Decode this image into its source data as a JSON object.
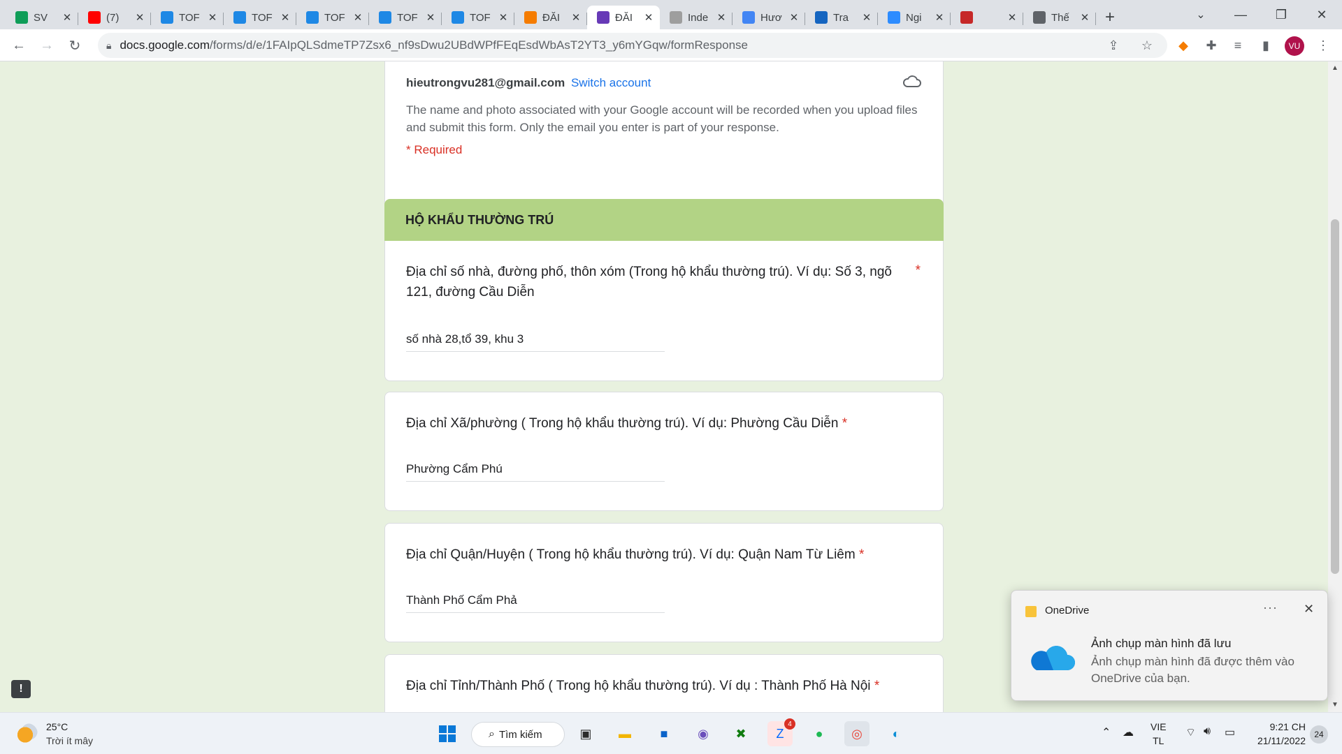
{
  "browser": {
    "tabs": [
      {
        "title": "SV",
        "icon": "sheets-icon",
        "color": "#0f9d58",
        "active": false
      },
      {
        "title": "(7)",
        "icon": "youtube-icon",
        "color": "#ff0000",
        "active": false
      },
      {
        "title": "TOF",
        "icon": "site-icon",
        "color": "#1e88e5",
        "active": false
      },
      {
        "title": "TOF",
        "icon": "site-icon",
        "color": "#1e88e5",
        "active": false
      },
      {
        "title": "TOF",
        "icon": "site-icon",
        "color": "#1e88e5",
        "active": false
      },
      {
        "title": "TOF",
        "icon": "site-icon",
        "color": "#1e88e5",
        "active": false
      },
      {
        "title": "TOF",
        "icon": "site-icon",
        "color": "#1e88e5",
        "active": false
      },
      {
        "title": "ĐĂI",
        "icon": "fpt-icon",
        "color": "#f57c00",
        "active": false
      },
      {
        "title": "ĐĂI",
        "icon": "forms-icon",
        "color": "#673ab7",
        "active": true
      },
      {
        "title": "Inde",
        "icon": "page-icon",
        "color": "#9e9e9e",
        "active": false
      },
      {
        "title": "Hươ",
        "icon": "docs-icon",
        "color": "#4285f4",
        "active": false
      },
      {
        "title": "Tra",
        "icon": "globe-icon",
        "color": "#1565c0",
        "active": false
      },
      {
        "title": "Ngi",
        "icon": "zoom-icon",
        "color": "#2d8cff",
        "active": false
      },
      {
        "title": "",
        "icon": "audio-icon",
        "color": "#c62828",
        "active": false
      },
      {
        "title": "Thế",
        "icon": "chrome-icon",
        "color": "#5f6368",
        "active": false
      }
    ],
    "url_host": "docs.google.com",
    "url_path": "/forms/d/e/1FAIpQLSdmeTP7Zsx6_nf9sDwu2UBdWPfFEqEsdWbAsT2YT3_y6mYGqw/formResponse",
    "profile_initials": "VU"
  },
  "form": {
    "account_email": "hieutrongvu281@gmail.com",
    "switch_account": "Switch account",
    "notice": "The name and photo associated with your Google account will be recorded when you upload files and submit this form. Only the email you enter is part of your response.",
    "required_note": "* Required",
    "section_title": "HỘ KHẨU THƯỜNG TRÚ",
    "questions": [
      {
        "title": "Địa chỉ số nhà, đường phố, thôn xóm (Trong hộ khẩu thường trú). Ví dụ: Số 3, ngõ 121, đường Cầu Diễn",
        "required": "*",
        "answer": "số nhà 28,tổ 39, khu 3"
      },
      {
        "title": "Địa chỉ Xã/phường ( Trong hộ khẩu thường trú). Ví dụ: Phường Cầu Diễn",
        "required": "*",
        "answer": "Phường Cẩm Phú"
      },
      {
        "title": "Địa chỉ Quận/Huyện ( Trong hộ khẩu thường trú). Ví dụ: Quận Nam Từ Liêm",
        "required": "*",
        "answer": "Thành Phố Cẩm Phả"
      },
      {
        "title": "Địa chỉ Tỉnh/Thành Phố ( Trong hộ khẩu thường trú). Ví dụ : Thành Phố Hà Nội",
        "required": "*",
        "answer": ""
      }
    ]
  },
  "toast": {
    "app": "OneDrive",
    "more": "···",
    "title": "Ảnh chụp màn hình đã lưu",
    "body": "Ảnh chụp màn hình đã được thêm vào OneDrive của bạn."
  },
  "taskbar": {
    "weather_temp": "25°C",
    "weather_desc": "Trời ít mây",
    "search_label": "Tìm kiếm",
    "zalo_badge": "4",
    "language_top": "VIE",
    "language_bottom": "TL",
    "time": "9:21 CH",
    "date": "21/11/2022",
    "notification_count": "24"
  },
  "colors": {
    "page_background": "#e8f1df",
    "section_header": "#b2d385",
    "required": "#d93025",
    "link": "#1a73e8"
  }
}
